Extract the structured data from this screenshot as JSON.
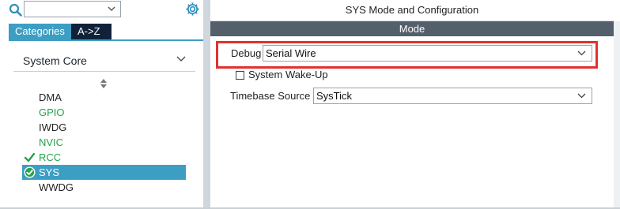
{
  "left_panel": {
    "search": {
      "value": "",
      "placeholder": ""
    },
    "tabs": [
      {
        "label": "Categories",
        "active": true
      },
      {
        "label": "A->Z",
        "active": false
      }
    ],
    "category": {
      "label": "System Core"
    },
    "peripherals": [
      {
        "label": "DMA",
        "state": "default"
      },
      {
        "label": "GPIO",
        "state": "configured"
      },
      {
        "label": "IWDG",
        "state": "default"
      },
      {
        "label": "NVIC",
        "state": "configured"
      },
      {
        "label": "RCC",
        "state": "checked"
      },
      {
        "label": "SYS",
        "state": "selected"
      },
      {
        "label": "WWDG",
        "state": "default"
      }
    ]
  },
  "right_panel": {
    "title": "SYS Mode and Configuration",
    "section": "Mode",
    "debug": {
      "label": "Debug",
      "value": "Serial Wire"
    },
    "wakeup": {
      "label": "System Wake-Up",
      "checked": false
    },
    "timebase": {
      "label": "Timebase Source",
      "value": "SysTick"
    }
  },
  "colors": {
    "accent": "#3d9ec4",
    "tab_dark": "#10223a",
    "configured_green": "#27a34a",
    "mode_bar": "#53606b",
    "highlight_red": "#e03131"
  },
  "icons": {
    "search": "search-icon",
    "settings": "gear-icon",
    "expand": "chevron-down-icon",
    "sort": "sort-icon",
    "check": "checkmark-icon",
    "selected_check": "check-circle-icon"
  }
}
